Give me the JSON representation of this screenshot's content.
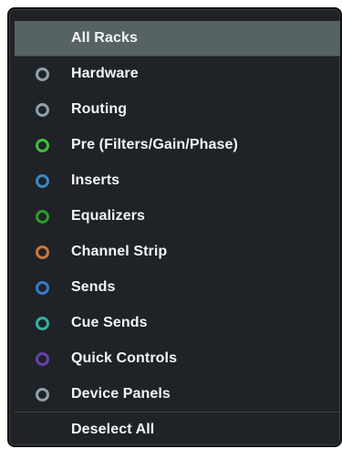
{
  "menu": {
    "header_label": "All Racks",
    "items": [
      {
        "label": "Hardware",
        "color": "#8fa0aa",
        "icon": "circle-ring-icon"
      },
      {
        "label": "Routing",
        "color": "#8fa0aa",
        "icon": "circle-ring-icon"
      },
      {
        "label": "Pre (Filters/Gain/Phase)",
        "color": "#3fbf3f",
        "icon": "circle-ring-icon"
      },
      {
        "label": "Inserts",
        "color": "#3b88c2",
        "icon": "circle-ring-icon"
      },
      {
        "label": "Equalizers",
        "color": "#2f9a2f",
        "icon": "circle-ring-icon"
      },
      {
        "label": "Channel Strip",
        "color": "#c8783b",
        "icon": "circle-ring-icon"
      },
      {
        "label": "Sends",
        "color": "#3a78c8",
        "icon": "circle-ring-icon"
      },
      {
        "label": "Cue Sends",
        "color": "#2fb3a0",
        "icon": "circle-ring-icon"
      },
      {
        "label": "Quick Controls",
        "color": "#6a3fa8",
        "icon": "circle-ring-icon"
      },
      {
        "label": "Device Panels",
        "color": "#8fa0aa",
        "icon": "circle-ring-icon"
      }
    ],
    "footer_label": "Deselect All"
  }
}
